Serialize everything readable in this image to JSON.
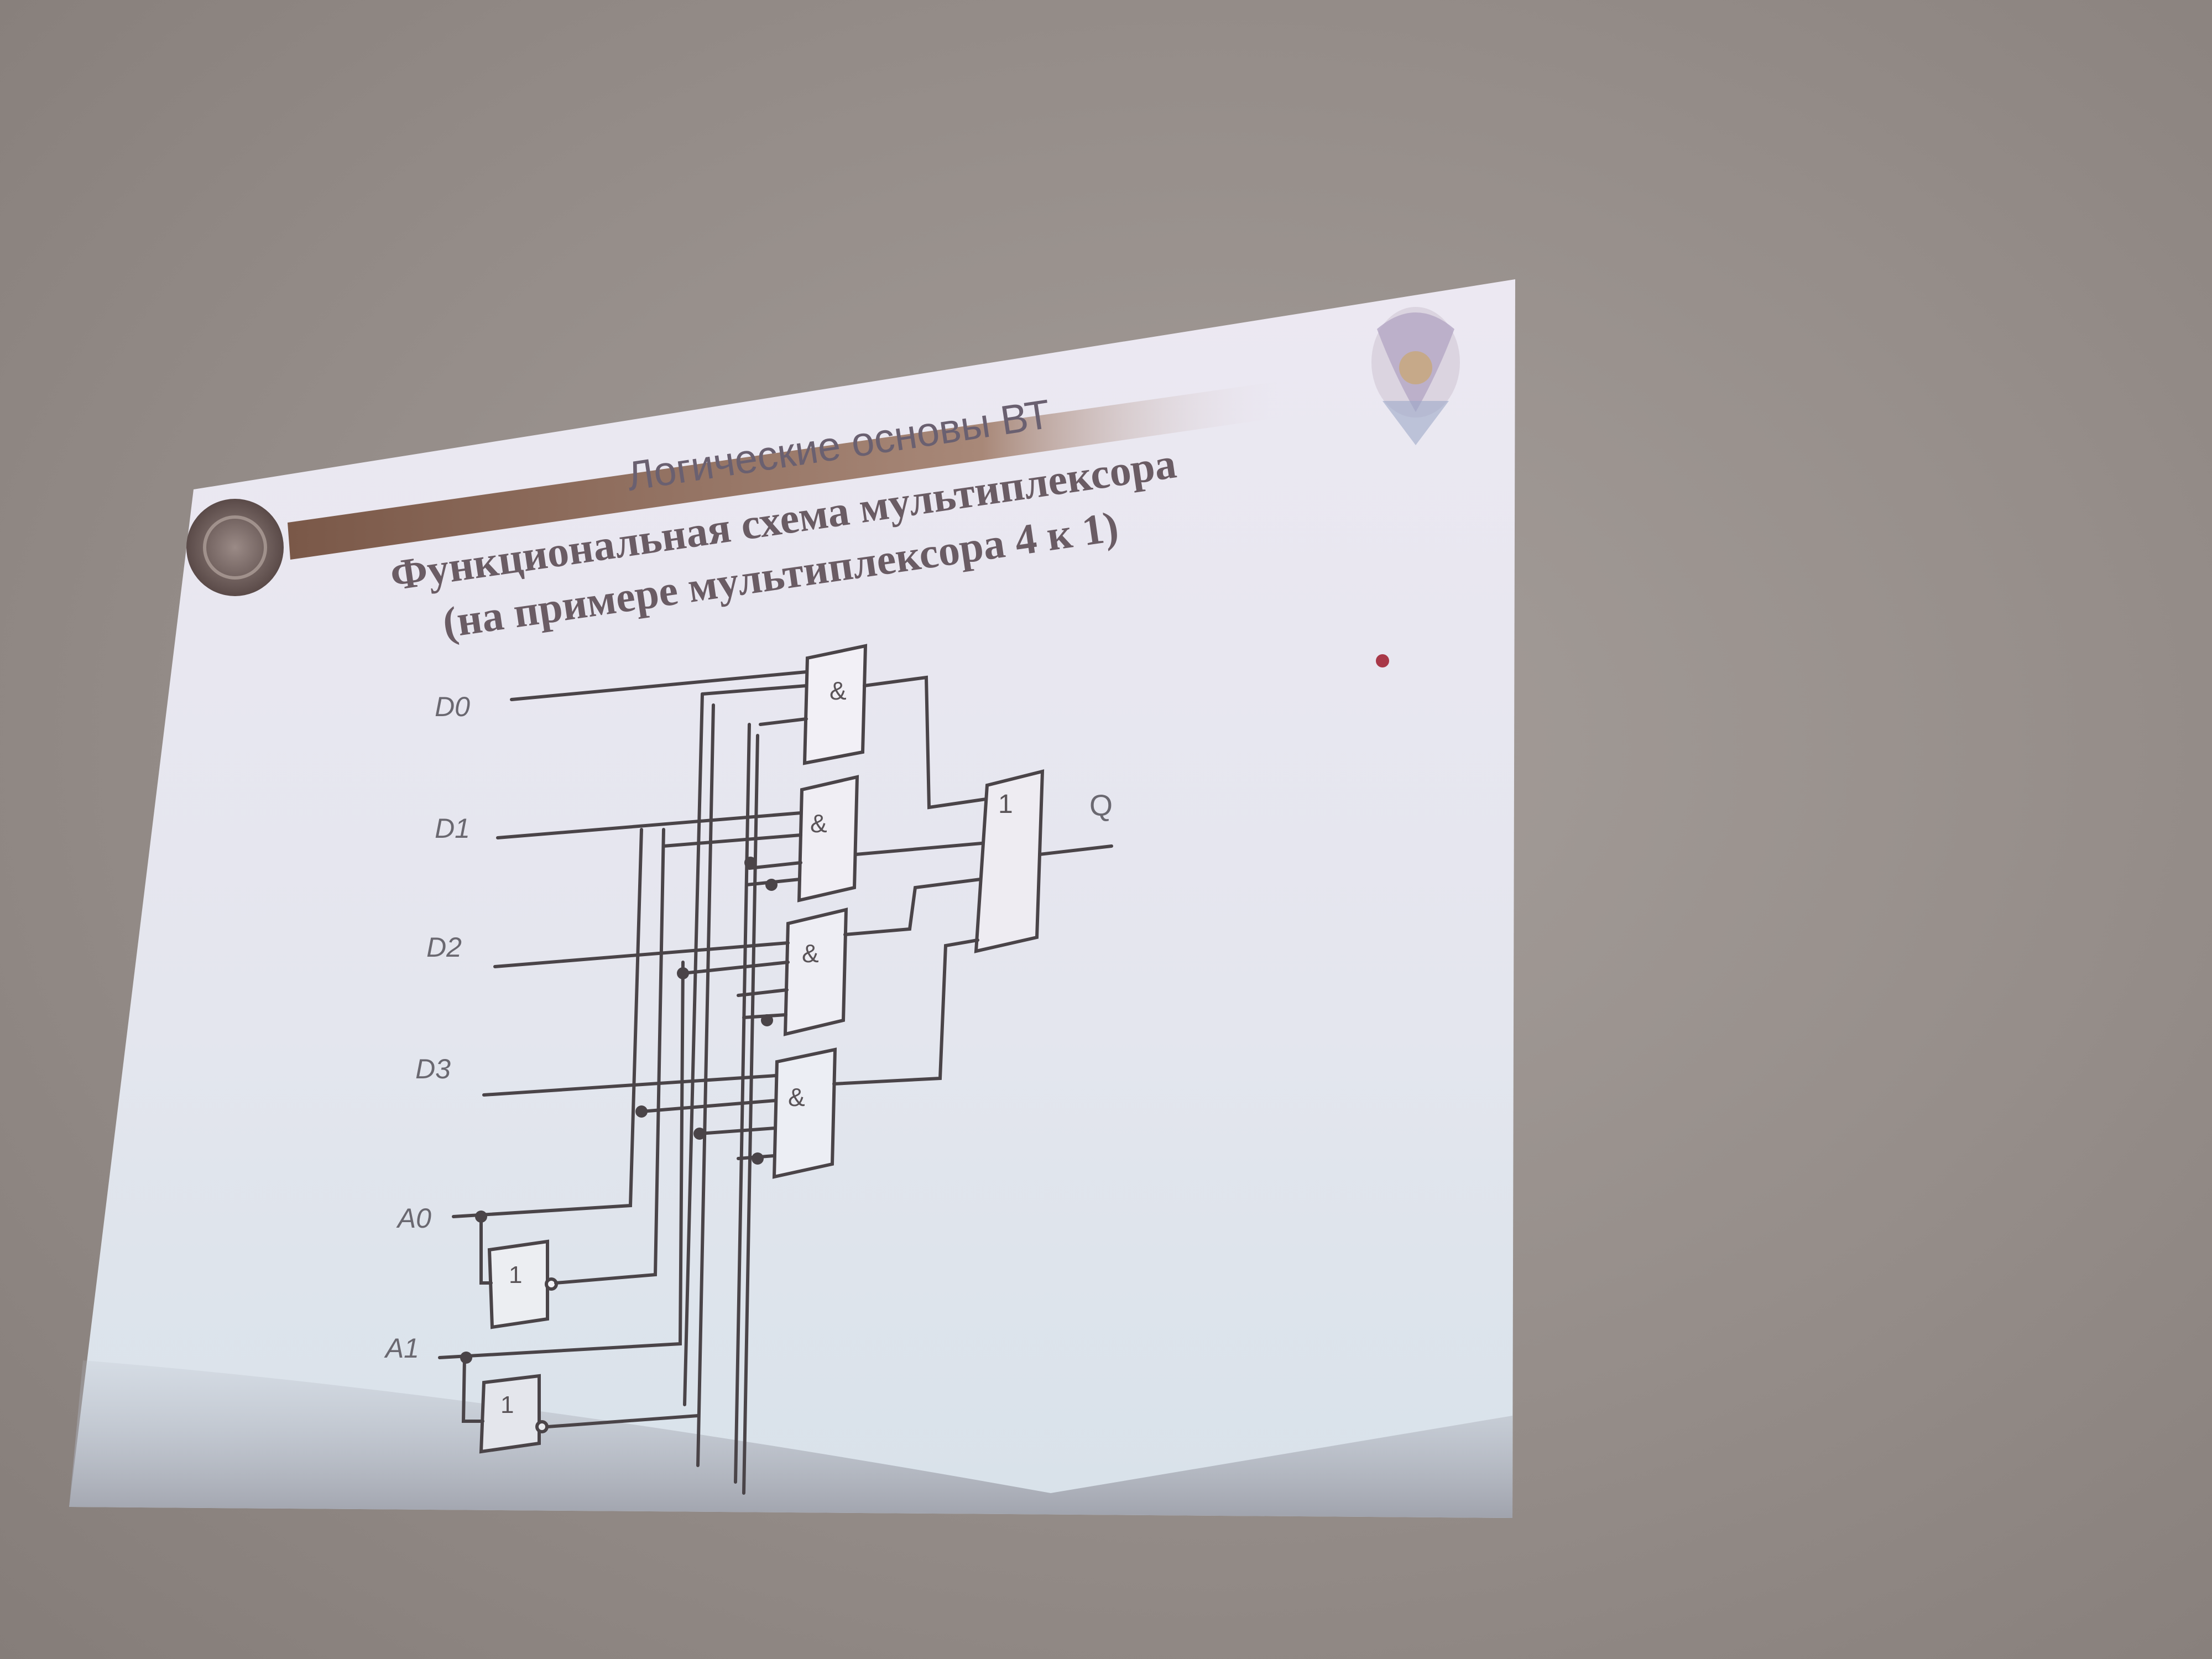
{
  "slide": {
    "header": "Логические основы ВТ",
    "title_line1": "Функциональная схема мультиплексора",
    "title_line2": "(на примере мультиплексора 4 к 1)"
  },
  "circuit": {
    "inputs": [
      "D0",
      "D1",
      "D2",
      "D3"
    ],
    "address_inputs": [
      "A0",
      "A1"
    ],
    "output": "Q",
    "and_gate_symbol": "&",
    "or_gate_symbol": "1",
    "inverter_symbol": "1"
  },
  "colors": {
    "slide_top": "#ece8f2",
    "slide_bottom": "#dfe6ee",
    "header_bar": "#8a6a5a",
    "wire": "#4a4448",
    "room": "#9a928e"
  },
  "icons": {
    "emblem": "university-emblem-icon",
    "badge": "round-logo-icon",
    "laser_dot": "laser-pointer-dot"
  }
}
